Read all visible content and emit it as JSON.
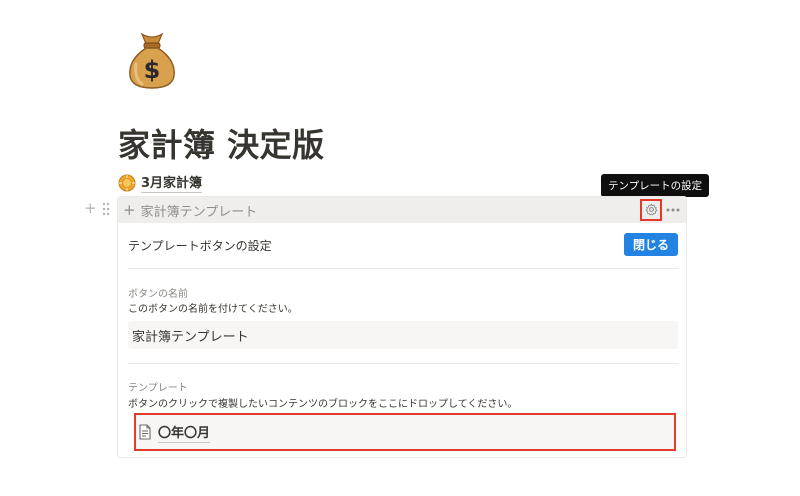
{
  "page": {
    "icon": "money-bag-icon",
    "title": "家計簿 決定版"
  },
  "subpage": {
    "icon": "coin-icon",
    "label": "3月家計簿"
  },
  "tooltip": {
    "text": "テンプレートの設定"
  },
  "template_button": {
    "label": "家計簿テンプレート",
    "settings_icon": "gear-icon",
    "more_icon": "more-icon"
  },
  "settings_panel": {
    "title": "テンプレートボタンの設定",
    "close_label": "閉じる",
    "name_section": {
      "label": "ボタンの名前",
      "help": "このボタンの名前を付けてください。",
      "value": "家計簿テンプレート"
    },
    "template_section": {
      "label": "テンプレート",
      "help": "ボタンのクリックで複製したいコンテンツのブロックをここにドロップしてください。",
      "item_label": "〇年〇月",
      "item_icon": "document-icon"
    }
  },
  "colors": {
    "accent": "#2383e2",
    "highlight": "#e5392b",
    "text": "#37352f"
  }
}
